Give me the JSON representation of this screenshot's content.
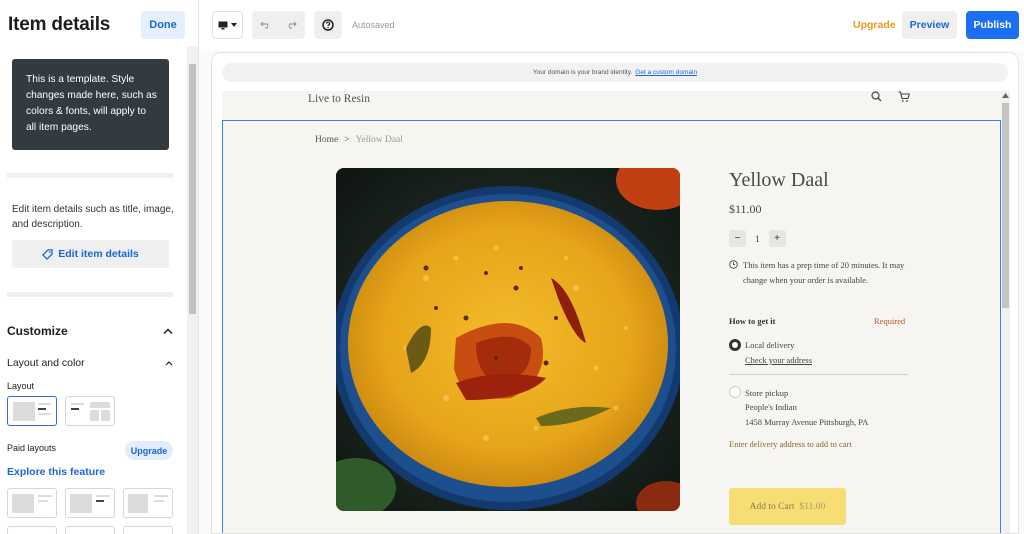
{
  "panel": {
    "title": "Item details",
    "done_label": "Done",
    "template_note": "This is a template. Style changes made here, such as colors & fonts, will apply to all item pages.",
    "edit_description": "Edit item details such as title, image, and description.",
    "edit_button_label": "Edit item details",
    "customize_label": "Customize",
    "layout_color_label": "Layout and color",
    "layout_label": "Layout",
    "paid_layouts_label": "Paid layouts",
    "upgrade_label": "Upgrade",
    "explore_label": "Explore this feature"
  },
  "toolbar": {
    "autosaved": "Autosaved",
    "upgrade_label": "Upgrade",
    "preview_label": "Preview",
    "publish_label": "Publish"
  },
  "site": {
    "domain_note": "Your domain is your brand identity.",
    "domain_link": "Get a custom domain",
    "brand": "Live to Resin",
    "breadcrumb_home": "Home",
    "breadcrumb_sep": ">",
    "breadcrumb_current": "Yellow Daal"
  },
  "product": {
    "title": "Yellow Daal",
    "price": "$11.00",
    "qty_minus": "−",
    "quantity": "1",
    "qty_plus": "+",
    "prep_note": "This item has a prep time of 20 minutes. It may change when your order is available.",
    "how_label": "How to get it",
    "required_label": "Required",
    "delivery_label": "Local delivery",
    "check_address": "Check your address",
    "pickup_label": "Store pickup",
    "store_name": "People's Indian",
    "store_address": "1458 Murray Avenue Pittsburgh, PA",
    "enter_address": "Enter delivery address to add to cart",
    "cart_label": "Add to Cart",
    "cart_price": "$11.00"
  },
  "colors": {
    "accent": "#1a6ff2",
    "upgrade": "#e89b1d",
    "cart_button": "#f7de74",
    "required": "#b5532f"
  }
}
